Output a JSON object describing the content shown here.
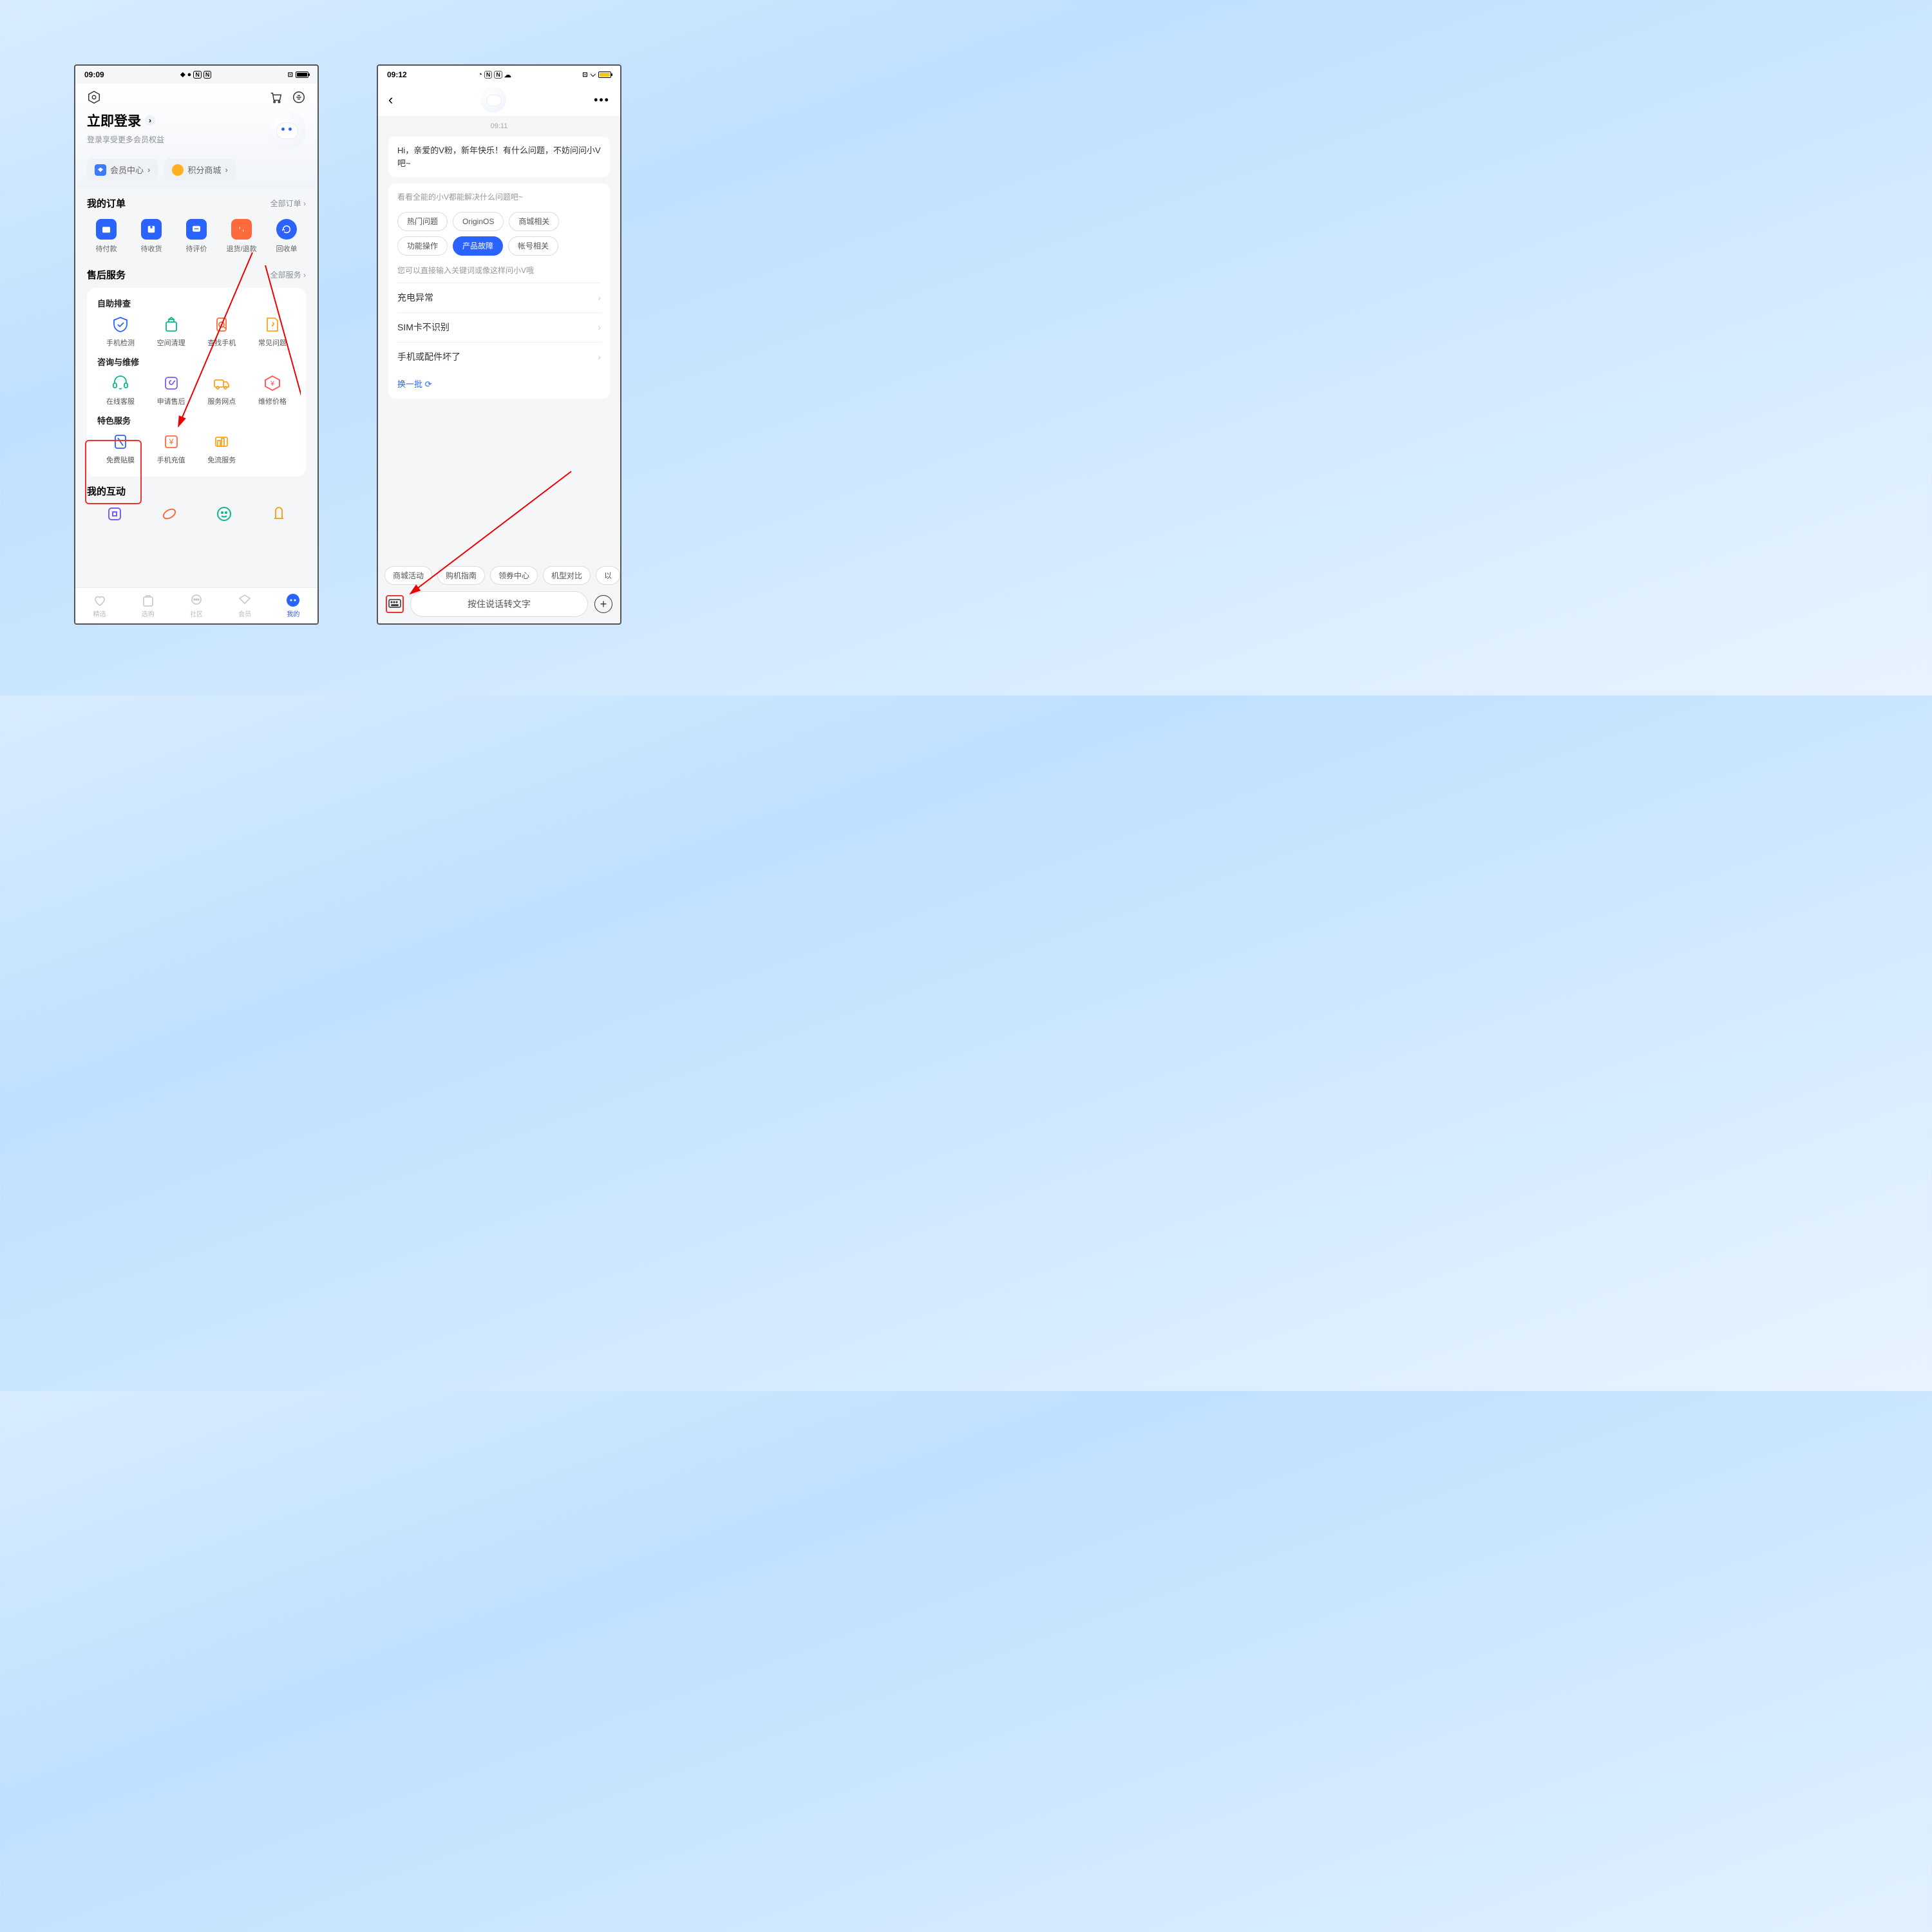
{
  "phone1": {
    "status": {
      "time": "09:09"
    },
    "login": {
      "title": "立即登录",
      "sub": "登录享受更多会员权益"
    },
    "pills": {
      "member": "会员中心",
      "points": "积分商城"
    },
    "orders": {
      "title": "我的订单",
      "more": "全部订单",
      "items": [
        "待付款",
        "待收货",
        "待评价",
        "退货/退款",
        "回收单"
      ]
    },
    "service": {
      "title": "售后服务",
      "more": "全部服务",
      "sec1": {
        "title": "自助排查",
        "items": [
          "手机检测",
          "空间清理",
          "查找手机",
          "常见问题"
        ]
      },
      "sec2": {
        "title": "咨询与维修",
        "items": [
          "在线客服",
          "申请售后",
          "服务网点",
          "维修价格"
        ]
      },
      "sec3": {
        "title": "特色服务",
        "items": [
          "免费贴膜",
          "手机充值",
          "免流服务"
        ]
      }
    },
    "interact": {
      "title": "我的互动"
    },
    "nav": [
      "精选",
      "选购",
      "社区",
      "会员",
      "我的"
    ]
  },
  "phone2": {
    "status": {
      "time": "09:12"
    },
    "chat_time": "09:11",
    "greeting": "Hi，亲爱的V粉，新年快乐！有什么问题，不妨问问小V吧~",
    "hint": "看看全能的小V都能解决什么问题吧~",
    "chips": [
      "热门问题",
      "OriginOS",
      "商城相关",
      "功能操作",
      "产品故障",
      "帐号相关"
    ],
    "active_chip": 4,
    "qhint": "您可以直接输入关键词或像这样问小V哦",
    "qs": [
      "充电异常",
      "SIM卡不识别",
      "手机或配件坏了"
    ],
    "refresh": "换一批",
    "bottom_chips": [
      "商城活动",
      "购机指南",
      "领券中心",
      "机型对比",
      "以"
    ],
    "voice": "按住说话转文字"
  }
}
